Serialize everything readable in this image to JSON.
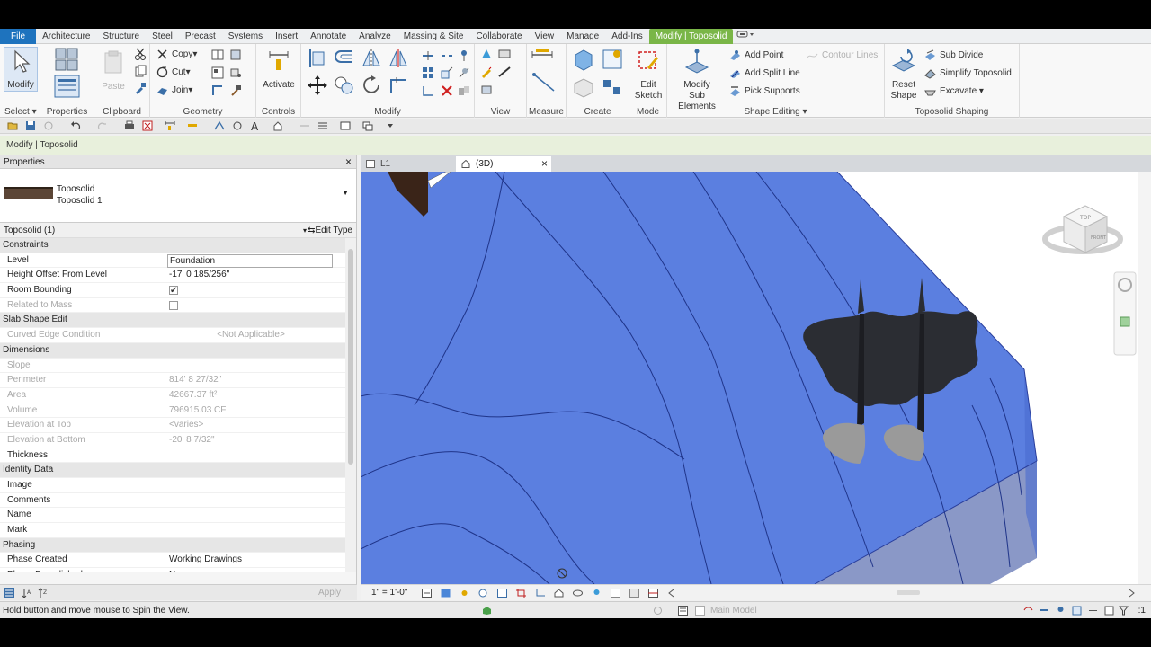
{
  "menu": {
    "items": [
      "File",
      "Architecture",
      "Structure",
      "Steel",
      "Precast",
      "Systems",
      "Insert",
      "Annotate",
      "Analyze",
      "Massing & Site",
      "Collaborate",
      "View",
      "Manage",
      "Add-Ins",
      "Modify | Toposolid"
    ],
    "active": "Modify | Toposolid"
  },
  "ribbon": {
    "modify_label": "Modify",
    "select_label": "Select",
    "properties_label": "Properties",
    "paste_label": "Paste",
    "clipboard_label": "Clipboard",
    "copy_label": "Copy",
    "cut_label": "Cut",
    "join_label": "Join",
    "geometry_label": "Geometry",
    "activate_label": "Activate",
    "controls_label": "Controls",
    "modify_group_label": "Modify",
    "view_label": "View",
    "measure_label": "Measure",
    "create_label": "Create",
    "edit_sketch_label": "Edit\nSketch",
    "mode_label": "Mode",
    "modify_sub_label": "Modify\nSub Elements",
    "add_point_label": "Add Point",
    "add_split_line_label": "Add Split Line",
    "pick_supports_label": "Pick Supports",
    "contour_lines_label": "Contour Lines",
    "shape_editing_label": "Shape Editing",
    "reset_shape_label": "Reset\nShape",
    "sub_divide_label": "Sub Divide",
    "simplify_label": "Simplify Toposolid",
    "excavate_label": "Excavate",
    "toposolid_shaping_label": "Toposolid Shaping"
  },
  "context_bar": "Modify | Toposolid",
  "properties": {
    "title": "Properties",
    "family": "Toposolid",
    "type": "Toposolid 1",
    "instance": "Toposolid (1)",
    "edit_type": "Edit Type",
    "apply": "Apply",
    "rows": [
      {
        "kind": "section",
        "label": "Constraints"
      },
      {
        "kind": "input",
        "label": "Level",
        "value": "Foundation"
      },
      {
        "kind": "text",
        "label": "Height Offset From Level",
        "value": "-17'  0 185/256\""
      },
      {
        "kind": "check",
        "label": "Room Bounding",
        "checked": true
      },
      {
        "kind": "check-grey",
        "label": "Related to Mass",
        "checked": false
      },
      {
        "kind": "section",
        "label": "Slab Shape Edit"
      },
      {
        "kind": "grey-center",
        "label": "Curved Edge Condition",
        "value": "<Not Applicable>"
      },
      {
        "kind": "section",
        "label": "Dimensions"
      },
      {
        "kind": "grey",
        "label": "Slope",
        "value": ""
      },
      {
        "kind": "grey",
        "label": "Perimeter",
        "value": "814'  8 27/32\""
      },
      {
        "kind": "grey",
        "label": "Area",
        "value": "42667.37 ft²"
      },
      {
        "kind": "grey",
        "label": "Volume",
        "value": "796915.03 CF"
      },
      {
        "kind": "grey",
        "label": "Elevation at Top",
        "value": "<varies>"
      },
      {
        "kind": "grey",
        "label": "Elevation at Bottom",
        "value": "-20'  8 7/32\""
      },
      {
        "kind": "text",
        "label": "Thickness",
        "value": ""
      },
      {
        "kind": "section",
        "label": "Identity Data"
      },
      {
        "kind": "text",
        "label": "Image",
        "value": ""
      },
      {
        "kind": "text",
        "label": "Comments",
        "value": ""
      },
      {
        "kind": "text",
        "label": "Name",
        "value": ""
      },
      {
        "kind": "text",
        "label": "Mark",
        "value": ""
      },
      {
        "kind": "section",
        "label": "Phasing"
      },
      {
        "kind": "text",
        "label": "Phase Created",
        "value": "Working Drawings"
      },
      {
        "kind": "text",
        "label": "Phase Demolished",
        "value": "None"
      }
    ]
  },
  "view_tabs": {
    "tab1": "L1",
    "tab2": "(3D)"
  },
  "viewcube": {
    "top": "TOP",
    "front": "FRONT"
  },
  "view_bar": {
    "scale": "1\" = 1'-0\""
  },
  "status": {
    "message": "Hold button and move mouse to Spin the View.",
    "model": "Main Model",
    "filter": ":1"
  },
  "colors": {
    "toposolid": "#5b7fe0",
    "toposolid_dark": "#3e5fc4",
    "contour": "#1f3489",
    "active_tab": "#7ab648",
    "file_tab": "#1e73be"
  }
}
